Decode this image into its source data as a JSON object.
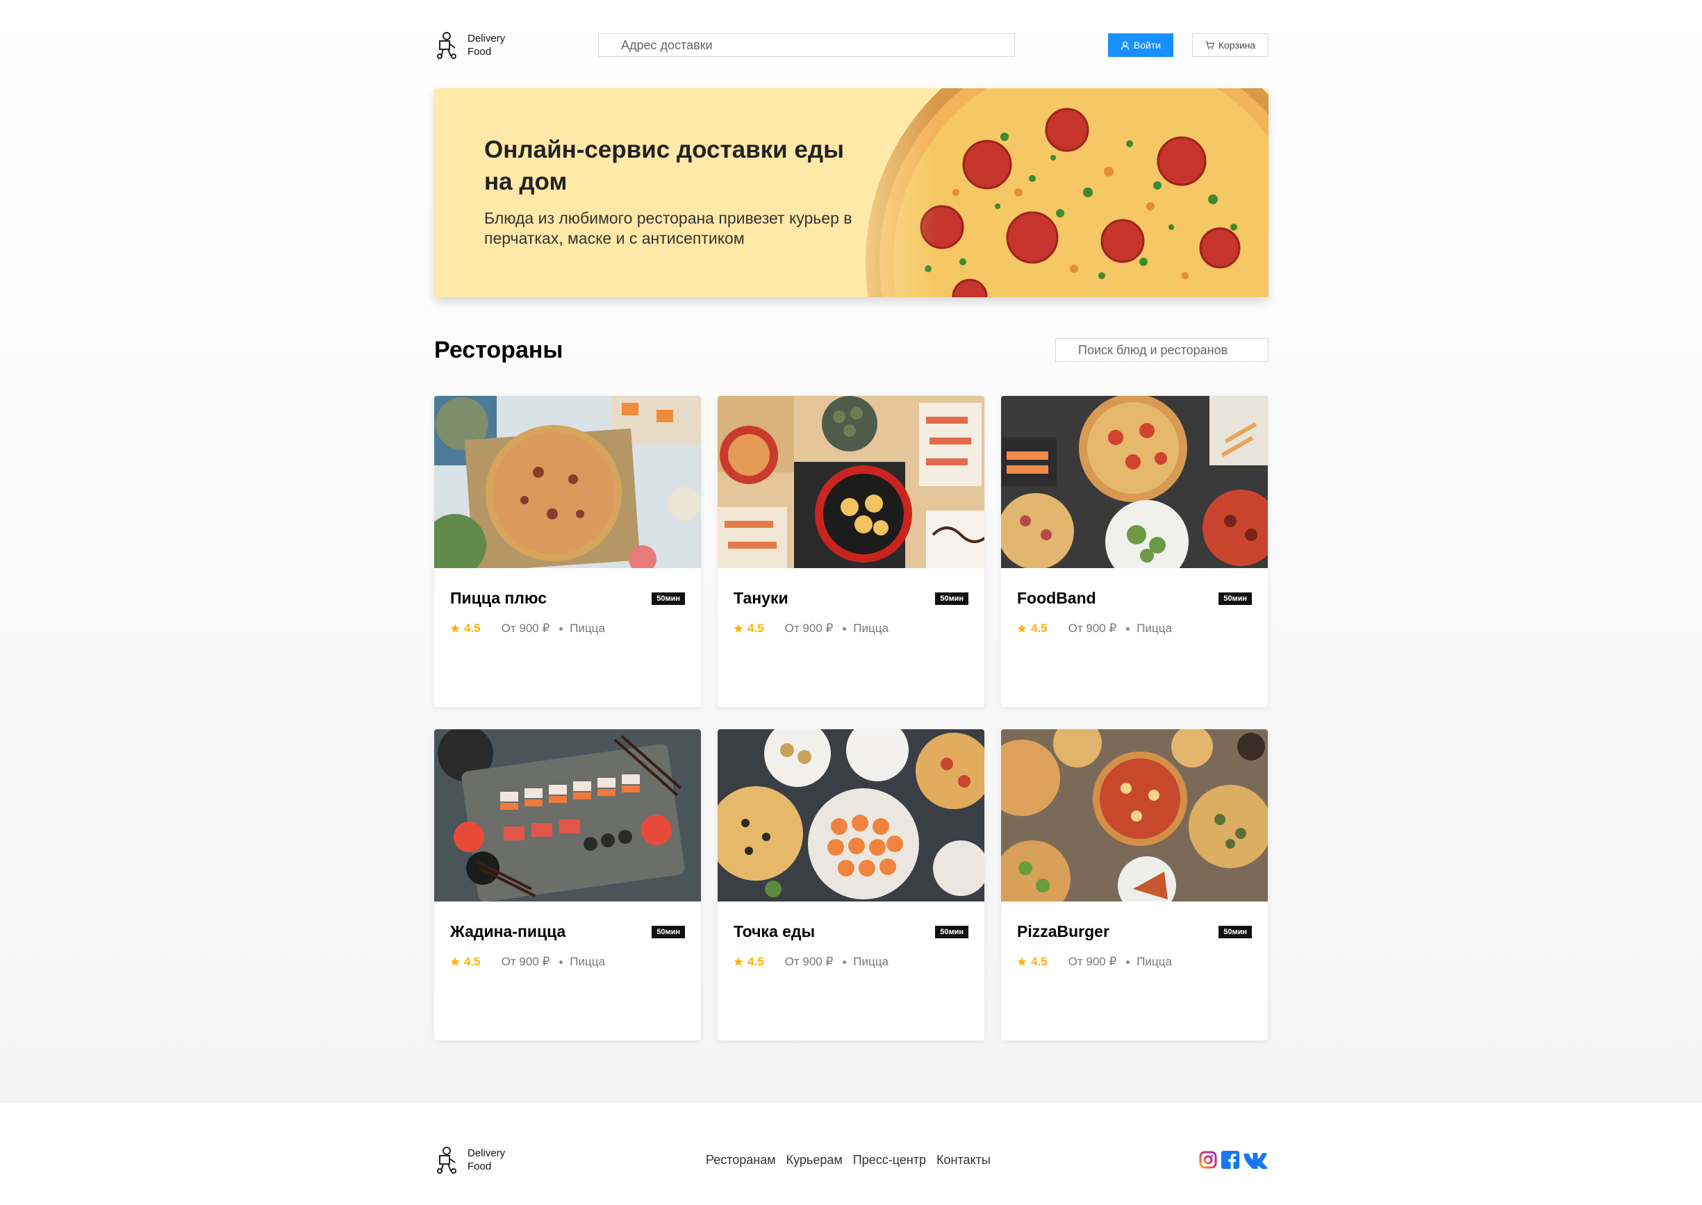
{
  "header": {
    "logo_line1": "Delivery",
    "logo_line2": "Food",
    "address_placeholder": "Адрес доставки",
    "login_label": "Войти",
    "cart_label": "Корзина"
  },
  "promo": {
    "title": "Онлайн-сервис доставки еды на дом",
    "text": "Блюда из любимого ресторана привезет курьер в перчатках, маске и с антисептиком"
  },
  "restaurants": {
    "title": "Рестораны",
    "search_placeholder": "Поиск блюд и ресторанов",
    "cards": [
      {
        "name": "Пицца плюс",
        "time": "50мин",
        "rating": "4.5",
        "price": "От 900 ₽",
        "category": "Пицца"
      },
      {
        "name": "Тануки",
        "time": "50мин",
        "rating": "4.5",
        "price": "От 900 ₽",
        "category": "Пицца"
      },
      {
        "name": "FoodBand",
        "time": "50мин",
        "rating": "4.5",
        "price": "От 900 ₽",
        "category": "Пицца"
      },
      {
        "name": "Жадина-пицца",
        "time": "50мин",
        "rating": "4.5",
        "price": "От 900 ₽",
        "category": "Пицца"
      },
      {
        "name": "Точка еды",
        "time": "50мин",
        "rating": "4.5",
        "price": "От 900 ₽",
        "category": "Пицца"
      },
      {
        "name": "PizzaBurger",
        "time": "50мин",
        "rating": "4.5",
        "price": "От 900 ₽",
        "category": "Пицца"
      }
    ]
  },
  "footer": {
    "logo_line1": "Delivery",
    "logo_line2": "Food",
    "links": [
      "Ресторанам",
      "Курьерам",
      "Пресс-центр",
      "Контакты"
    ]
  },
  "colors": {
    "accent": "#1890ff",
    "promo_bg": "#ffe9a8",
    "rating": "#ffb300",
    "instagram": "#e1306c",
    "facebook": "#1877f2",
    "vk": "#4c75a3"
  },
  "icons": [
    "courier-logo-icon",
    "user-icon",
    "cart-icon",
    "star-icon",
    "instagram-icon",
    "facebook-icon",
    "vk-icon"
  ]
}
